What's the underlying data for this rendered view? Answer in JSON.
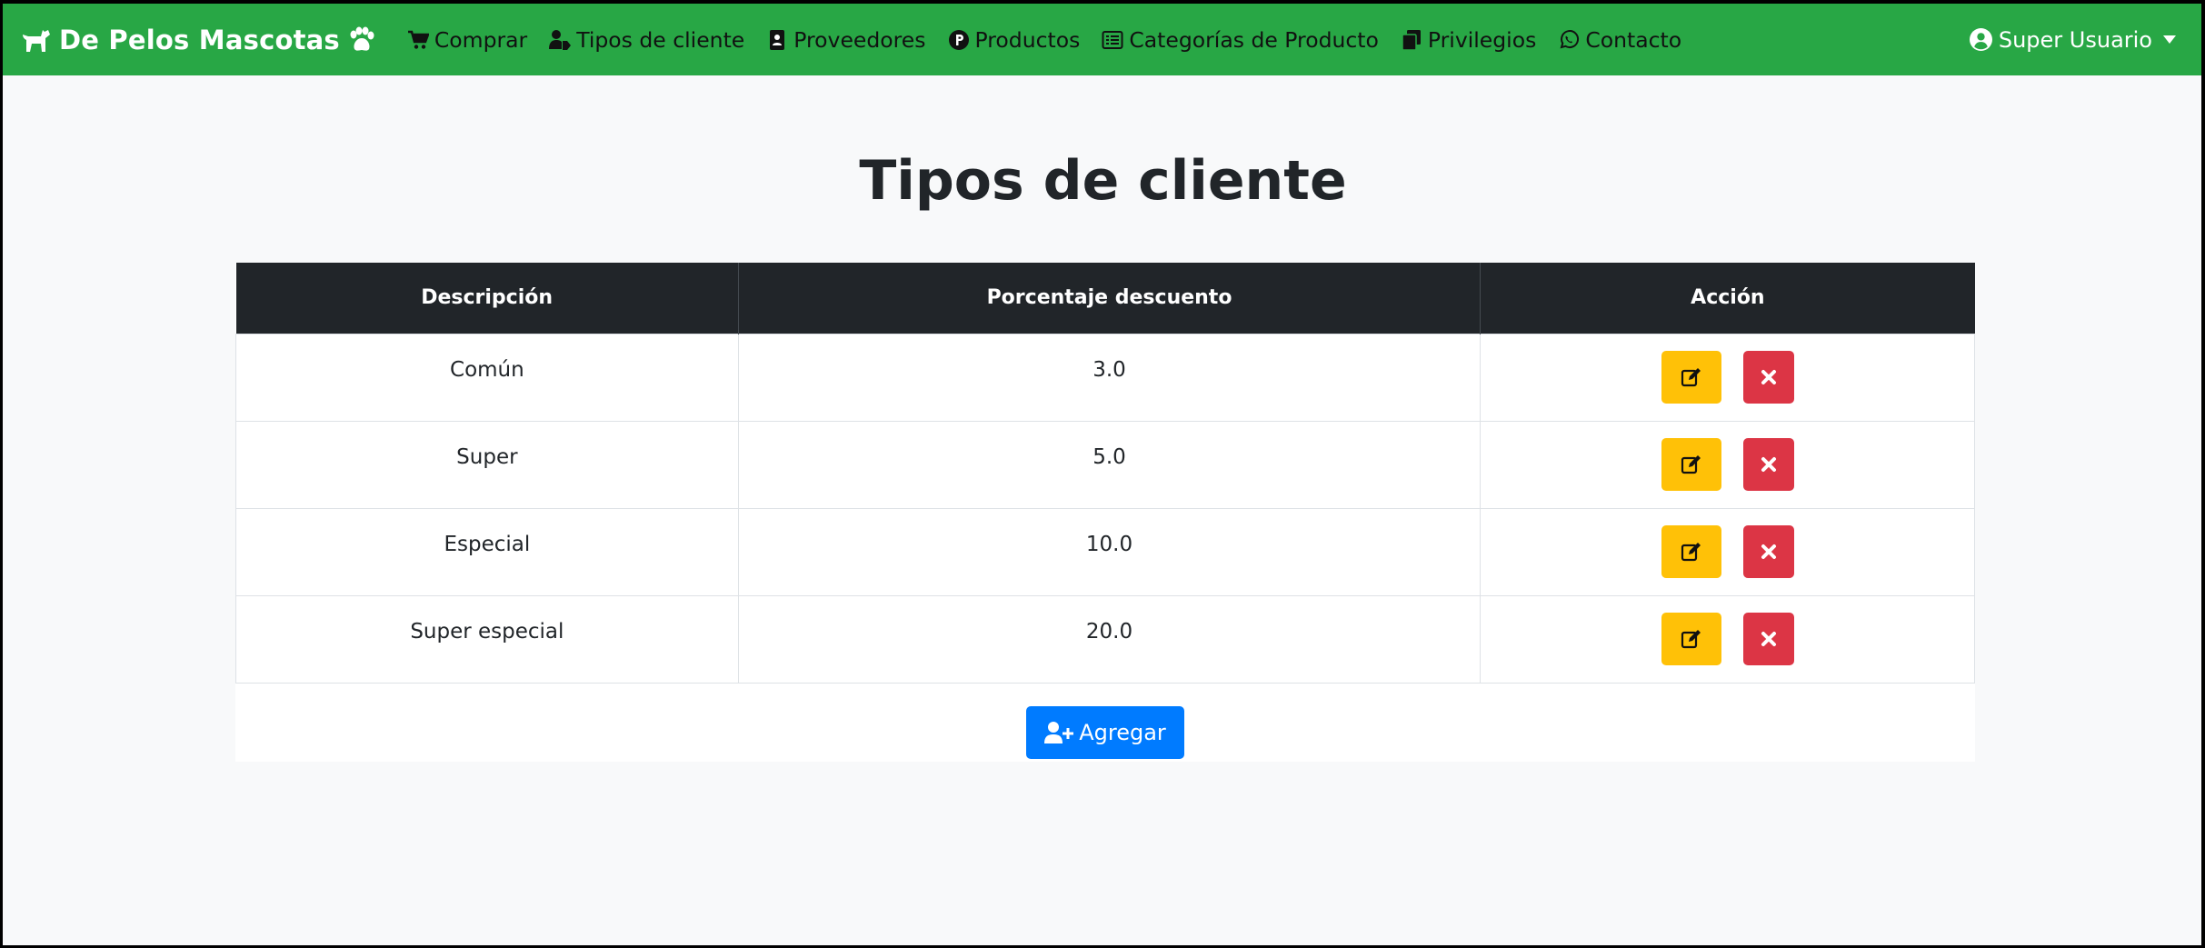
{
  "navbar": {
    "brand": "De Pelos Mascotas",
    "brand_icon": "dog-icon",
    "brand_trailing_icon": "paw-icon",
    "items": [
      {
        "label": "Comprar",
        "icon": "cart-icon"
      },
      {
        "label": "Tipos de cliente",
        "icon": "user-tag-icon"
      },
      {
        "label": "Proveedores",
        "icon": "address-book-icon"
      },
      {
        "label": "Productos",
        "icon": "product-hunt-icon"
      },
      {
        "label": "Categorías de Producto",
        "icon": "list-alt-icon"
      },
      {
        "label": "Privilegios",
        "icon": "copy-icon"
      },
      {
        "label": "Contacto",
        "icon": "whatsapp-icon"
      }
    ],
    "user": {
      "label": "Super Usuario",
      "icon": "user-circle-icon"
    },
    "color": "#28a745"
  },
  "page": {
    "title": "Tipos de cliente"
  },
  "table": {
    "headers": [
      "Descripción",
      "Porcentaje descuento",
      "Acción"
    ],
    "rows": [
      {
        "descripcion": "Común",
        "porcentaje": "3.0"
      },
      {
        "descripcion": "Super",
        "porcentaje": "5.0"
      },
      {
        "descripcion": "Especial",
        "porcentaje": "10.0"
      },
      {
        "descripcion": "Super especial",
        "porcentaje": "20.0"
      }
    ],
    "edit_icon": "edit-icon",
    "delete_icon": "times-icon",
    "edit_color": "#ffc107",
    "delete_color": "#dc3545"
  },
  "add_button": {
    "label": "Agregar",
    "icon": "user-plus-icon",
    "color": "#007bff"
  }
}
